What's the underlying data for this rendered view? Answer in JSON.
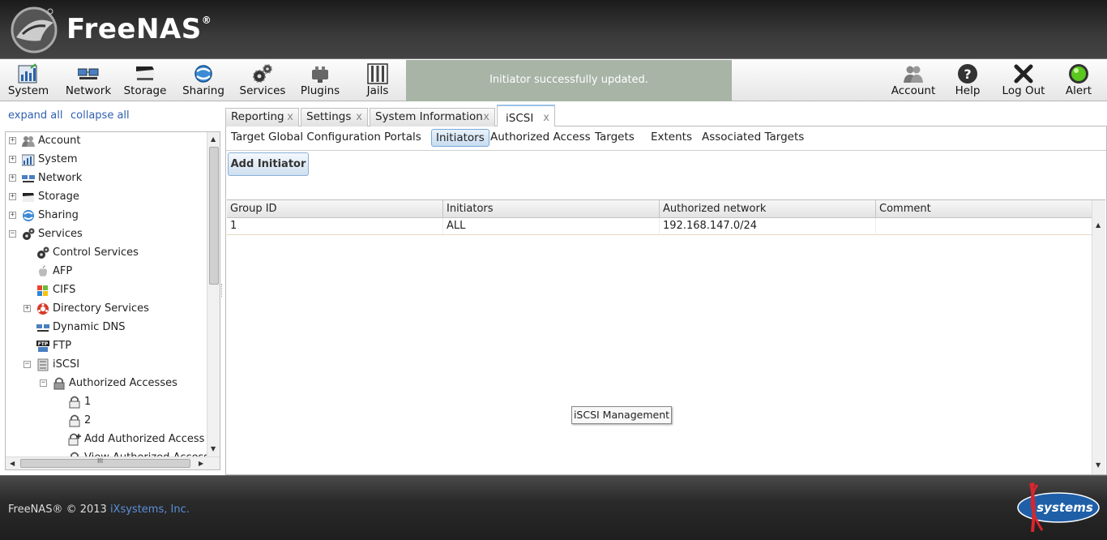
{
  "app": {
    "title": "FreeNAS",
    "trademark": "®"
  },
  "toolbar": {
    "left": [
      {
        "label": "System",
        "icon": "system-chart-icon"
      },
      {
        "label": "Network",
        "icon": "network-computers-icon"
      },
      {
        "label": "Storage",
        "icon": "storage-drive-icon"
      },
      {
        "label": "Sharing",
        "icon": "sharing-globe-icon"
      },
      {
        "label": "Services",
        "icon": "services-gears-icon"
      },
      {
        "label": "Plugins",
        "icon": "plugins-puzzle-icon"
      },
      {
        "label": "Jails",
        "icon": "jails-bars-icon"
      }
    ],
    "notice": "Initiator successfully updated.",
    "right": [
      {
        "label": "Account",
        "icon": "account-users-icon"
      },
      {
        "label": "Help",
        "icon": "help-question-icon"
      },
      {
        "label": "Log Out",
        "icon": "logout-x-icon"
      },
      {
        "label": "Alert",
        "icon": "alert-green-light-icon",
        "status_color": "#5ac81e"
      }
    ]
  },
  "tree_controls": {
    "expand_all": "expand all",
    "collapse_all": "collapse all"
  },
  "tree": {
    "nodes": [
      {
        "label": "Account",
        "toggle": "+"
      },
      {
        "label": "System",
        "toggle": "+"
      },
      {
        "label": "Network",
        "toggle": "+"
      },
      {
        "label": "Storage",
        "toggle": "+"
      },
      {
        "label": "Sharing",
        "toggle": "+"
      },
      {
        "label": "Services",
        "toggle": "−"
      },
      {
        "label": "Control Services"
      },
      {
        "label": "AFP"
      },
      {
        "label": "CIFS"
      },
      {
        "label": "Directory Services",
        "toggle": "+"
      },
      {
        "label": "Dynamic DNS"
      },
      {
        "label": "FTP"
      },
      {
        "label": "iSCSI",
        "toggle": "−"
      },
      {
        "label": "Authorized Accesses",
        "toggle": "−"
      },
      {
        "label": "1"
      },
      {
        "label": "2"
      },
      {
        "label": "Add Authorized Access"
      },
      {
        "label": "View Authorized Accesses"
      }
    ],
    "scroll_label": "III"
  },
  "tabs": [
    {
      "label": "Reporting",
      "close": "x"
    },
    {
      "label": "Settings",
      "close": "x"
    },
    {
      "label": "System Information",
      "close": "x"
    },
    {
      "label": "iSCSI",
      "close": "x",
      "active": true
    }
  ],
  "subtabs": [
    "Target Global Configuration",
    "Portals",
    "Initiators",
    "Authorized Access",
    "Targets",
    "Extents",
    "Associated Targets"
  ],
  "active_subtab": "Initiators",
  "add_button": "Add Initiator",
  "grid": {
    "columns": [
      "Group ID",
      "Initiators",
      "Authorized network",
      "Comment"
    ],
    "rows": [
      [
        "1",
        "ALL",
        "192.168.147.0/24",
        ""
      ]
    ]
  },
  "tooltip": "iSCSI Management",
  "footer": {
    "text": "FreeNAS® © 2013 ",
    "link": "iXsystems, Inc.",
    "logo_text": "systems"
  },
  "colors": {
    "header_bg": "#2b2b2b",
    "notice_bg": "#a7b4a6",
    "link": "#3060b0",
    "active_tab_accent": "#9cc3e5"
  }
}
